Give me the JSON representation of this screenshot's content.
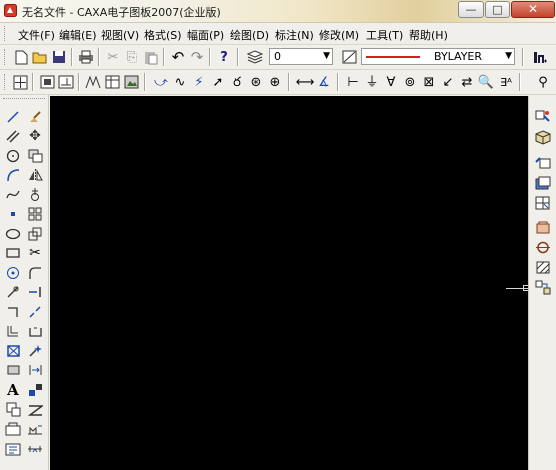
{
  "window": {
    "title": "无名文件 - CAXA电子图板2007(企业版)",
    "minimize": "—",
    "maximize": "□",
    "close": "✕"
  },
  "menu": [
    {
      "label": "文件(F)"
    },
    {
      "label": "编辑(E)"
    },
    {
      "label": "视图(V)"
    },
    {
      "label": "格式(S)"
    },
    {
      "label": "幅面(P)"
    },
    {
      "label": "绘图(D)"
    },
    {
      "label": "标注(N)"
    },
    {
      "label": "修改(M)"
    },
    {
      "label": "工具(T)"
    },
    {
      "label": "帮助(H)"
    }
  ],
  "toolbar1": {
    "layer_value": "0",
    "linetype_value": "BYLAYER",
    "line_color": "#d02020"
  },
  "icons": {
    "new": "🗋",
    "open": "📂",
    "save": "💾",
    "print": "🖶",
    "cut": "✂",
    "copy": "⎘",
    "paste": "📋",
    "undo": "↶",
    "redo": "↷",
    "help": "?",
    "layers": "≣",
    "linetype": "⧄",
    "brush": "Ո"
  },
  "colors": {
    "canvas": "#000000",
    "toolbar_bg": "#f0efea"
  }
}
